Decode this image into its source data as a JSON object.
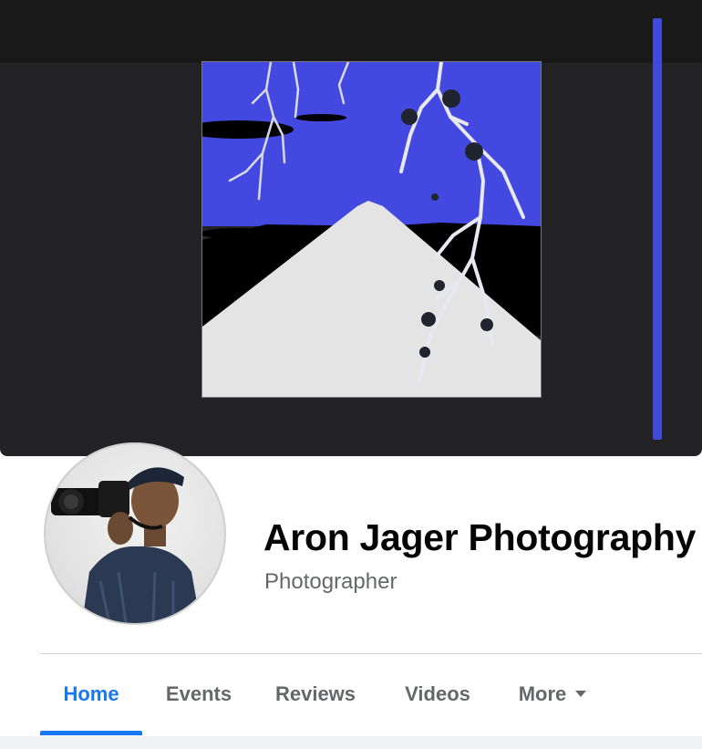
{
  "page": {
    "name": "Aron Jager Photography",
    "category": "Photographer"
  },
  "tabs": [
    {
      "label": "Home",
      "active": true
    },
    {
      "label": "Events",
      "active": false
    },
    {
      "label": "Reviews",
      "active": false
    },
    {
      "label": "Videos",
      "active": false
    },
    {
      "label": "More",
      "active": false,
      "icon": "caret-down-icon"
    }
  ],
  "colors": {
    "accent": "#1877f2",
    "cover_sky": "#4349e0",
    "cover_background": "#232325"
  }
}
